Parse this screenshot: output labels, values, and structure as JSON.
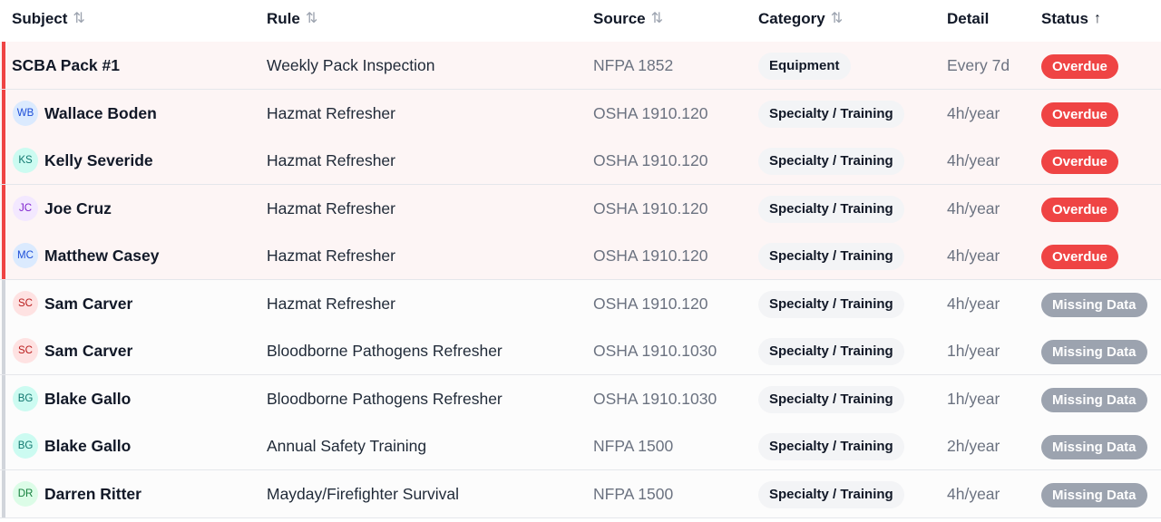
{
  "columns": {
    "subject": {
      "label": "Subject",
      "sort_icon": "sort-both-icon",
      "sort_glyph": "⇅"
    },
    "rule": {
      "label": "Rule",
      "sort_icon": "sort-both-icon",
      "sort_glyph": "⇅"
    },
    "source": {
      "label": "Source",
      "sort_icon": "sort-both-icon",
      "sort_glyph": "⇅"
    },
    "category": {
      "label": "Category",
      "sort_icon": "sort-both-icon",
      "sort_glyph": "⇅"
    },
    "detail": {
      "label": "Detail"
    },
    "status": {
      "label": "Status",
      "sort_icon": "sort-ascending-icon",
      "sort_glyph": "↑"
    }
  },
  "colors": {
    "overdue": "#ef4444",
    "missing_data": "#9ca3af",
    "overdue_row_bg": "#fdf5f5"
  },
  "rows": [
    {
      "subject": "SCBA Pack #1",
      "initials": "",
      "avatar_bg": "",
      "avatar_fg": "",
      "rule": "Weekly Pack Inspection",
      "source": "NFPA 1852",
      "category": "Equipment",
      "detail": "Every 7d",
      "status": "Overdue",
      "status_kind": "overdue"
    },
    {
      "subject": "Wallace Boden",
      "initials": "WB",
      "avatar_bg": "#dbeafe",
      "avatar_fg": "#1d4ed8",
      "rule": "Hazmat Refresher",
      "source": "OSHA 1910.120",
      "category": "Specialty / Training",
      "detail": "4h/year",
      "status": "Overdue",
      "status_kind": "overdue"
    },
    {
      "subject": "Kelly Severide",
      "initials": "KS",
      "avatar_bg": "#ccfbf1",
      "avatar_fg": "#0f766e",
      "rule": "Hazmat Refresher",
      "source": "OSHA 1910.120",
      "category": "Specialty / Training",
      "detail": "4h/year",
      "status": "Overdue",
      "status_kind": "overdue"
    },
    {
      "subject": "Joe Cruz",
      "initials": "JC",
      "avatar_bg": "#f3e8ff",
      "avatar_fg": "#7e22ce",
      "rule": "Hazmat Refresher",
      "source": "OSHA 1910.120",
      "category": "Specialty / Training",
      "detail": "4h/year",
      "status": "Overdue",
      "status_kind": "overdue"
    },
    {
      "subject": "Matthew Casey",
      "initials": "MC",
      "avatar_bg": "#dbeafe",
      "avatar_fg": "#1d4ed8",
      "rule": "Hazmat Refresher",
      "source": "OSHA 1910.120",
      "category": "Specialty / Training",
      "detail": "4h/year",
      "status": "Overdue",
      "status_kind": "overdue"
    },
    {
      "subject": "Sam Carver",
      "initials": "SC",
      "avatar_bg": "#fee2e2",
      "avatar_fg": "#b91c1c",
      "rule": "Hazmat Refresher",
      "source": "OSHA 1910.120",
      "category": "Specialty / Training",
      "detail": "4h/year",
      "status": "Missing Data",
      "status_kind": "missing"
    },
    {
      "subject": "Sam Carver",
      "initials": "SC",
      "avatar_bg": "#fee2e2",
      "avatar_fg": "#b91c1c",
      "rule": "Bloodborne Pathogens Refresher",
      "source": "OSHA 1910.1030",
      "category": "Specialty / Training",
      "detail": "1h/year",
      "status": "Missing Data",
      "status_kind": "missing"
    },
    {
      "subject": "Blake Gallo",
      "initials": "BG",
      "avatar_bg": "#ccfbf1",
      "avatar_fg": "#0f766e",
      "rule": "Bloodborne Pathogens Refresher",
      "source": "OSHA 1910.1030",
      "category": "Specialty / Training",
      "detail": "1h/year",
      "status": "Missing Data",
      "status_kind": "missing"
    },
    {
      "subject": "Blake Gallo",
      "initials": "BG",
      "avatar_bg": "#ccfbf1",
      "avatar_fg": "#0f766e",
      "rule": "Annual Safety Training",
      "source": "NFPA 1500",
      "category": "Specialty / Training",
      "detail": "2h/year",
      "status": "Missing Data",
      "status_kind": "missing"
    },
    {
      "subject": "Darren Ritter",
      "initials": "DR",
      "avatar_bg": "#dcfce7",
      "avatar_fg": "#15803d",
      "rule": "Mayday/Firefighter Survival",
      "source": "NFPA 1500",
      "category": "Specialty / Training",
      "detail": "4h/year",
      "status": "Missing Data",
      "status_kind": "missing"
    }
  ]
}
